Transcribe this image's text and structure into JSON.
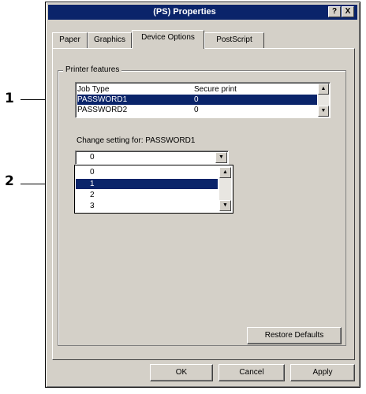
{
  "window": {
    "title": "(PS) Properties",
    "help_glyph": "?",
    "close_glyph": "X"
  },
  "tabs": [
    {
      "label": "Paper"
    },
    {
      "label": "Graphics"
    },
    {
      "label": "Device Options"
    },
    {
      "label": "PostScript"
    }
  ],
  "active_tab": "Device Options",
  "printer_features": {
    "legend": "Printer features",
    "header": {
      "col1": "Job Type",
      "col2": "Secure print"
    },
    "rows": [
      {
        "name": "PASSWORD1",
        "value": "0",
        "selected": true
      },
      {
        "name": "PASSWORD2",
        "value": "0",
        "selected": false
      }
    ]
  },
  "change_setting": {
    "label": "Change setting for: PASSWORD1",
    "current_value": "0",
    "options": [
      {
        "label": "0",
        "selected": false
      },
      {
        "label": "1",
        "selected": true
      },
      {
        "label": "2",
        "selected": false
      },
      {
        "label": "3",
        "selected": false
      }
    ]
  },
  "buttons": {
    "restore_defaults": "Restore Defaults",
    "ok": "OK",
    "cancel": "Cancel",
    "apply": "Apply"
  },
  "callouts": {
    "one": "1",
    "two": "2"
  },
  "colors": {
    "titlebar": "#0a246a",
    "selection": "#0a246a",
    "face": "#d4d0c8"
  }
}
